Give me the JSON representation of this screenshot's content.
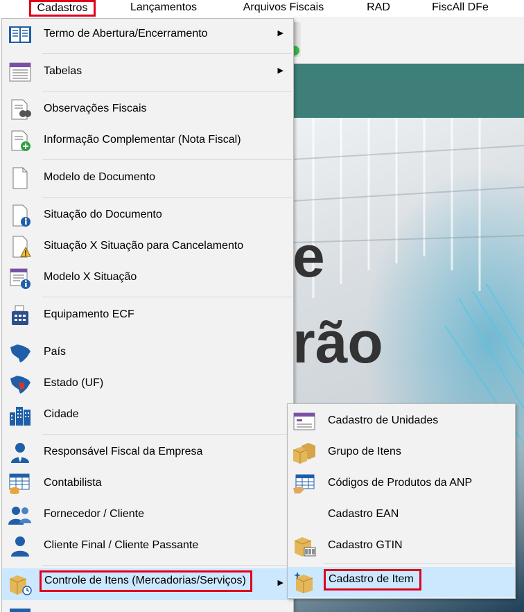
{
  "menubar": {
    "items": [
      {
        "label": "Cadastros",
        "highlighted": true
      },
      {
        "label": "Lançamentos",
        "highlighted": false
      },
      {
        "label": "Arquivos Fiscais",
        "highlighted": false
      },
      {
        "label": "RAD",
        "highlighted": false
      },
      {
        "label": "FiscAll DFe",
        "highlighted": false
      }
    ]
  },
  "main_menu": {
    "items": [
      {
        "label": "Termo de Abertura/Encerramento",
        "icon": "book-icon",
        "submenu": true
      },
      {
        "label": "Tabelas",
        "icon": "table-icon",
        "submenu": true
      },
      {
        "label": "Observações Fiscais",
        "icon": "document-search-icon",
        "submenu": false
      },
      {
        "label": "Informação Complementar (Nota Fiscal)",
        "icon": "document-add-icon",
        "submenu": false
      },
      {
        "label": "Modelo de Documento",
        "icon": "blank-document-icon",
        "submenu": false
      },
      {
        "label": "Situação do Documento",
        "icon": "document-info-icon",
        "submenu": false
      },
      {
        "label": "Situação X Situação para Cancelamento",
        "icon": "document-warning-icon",
        "submenu": false
      },
      {
        "label": "Modelo X Situação",
        "icon": "list-info-icon",
        "submenu": false
      },
      {
        "label": "Equipamento ECF",
        "icon": "cash-register-icon",
        "submenu": false
      },
      {
        "label": "País",
        "icon": "brazil-map-icon",
        "submenu": false
      },
      {
        "label": "Estado (UF)",
        "icon": "brazil-state-map-icon",
        "submenu": false
      },
      {
        "label": "Cidade",
        "icon": "city-buildings-icon",
        "submenu": false
      },
      {
        "label": "Responsável Fiscal da Empresa",
        "icon": "user-tie-icon",
        "submenu": false
      },
      {
        "label": "Contabilista",
        "icon": "spreadsheet-coins-icon",
        "submenu": false
      },
      {
        "label": "Fornecedor / Cliente",
        "icon": "users-group-icon",
        "submenu": false
      },
      {
        "label": "Cliente Final / Cliente Passante",
        "icon": "user-icon",
        "submenu": false
      },
      {
        "label": "Controle de Itens (Mercadorias/Serviços)",
        "icon": "package-clock-icon",
        "submenu": true,
        "active": true
      }
    ]
  },
  "sub_menu": {
    "items": [
      {
        "label": "Cadastro de Unidades",
        "icon": "window-list-icon"
      },
      {
        "label": "Grupo de Itens",
        "icon": "boxes-icon"
      },
      {
        "label": "Códigos de Produtos da ANP",
        "icon": "table-hand-icon"
      },
      {
        "label": "Cadastro EAN",
        "icon": ""
      },
      {
        "label": "Cadastro GTIN",
        "icon": "box-barcode-icon"
      },
      {
        "label": "Cadastro de Item",
        "icon": "box-sparkle-icon",
        "active": true
      }
    ]
  },
  "background": {
    "hero_line_1": "e",
    "hero_line_2": "rão"
  },
  "colors": {
    "highlight_border": "#e0001b",
    "menu_bg": "#f2f2f2",
    "active_item_bg": "#cce8ff",
    "teal_band": "#3f7f79"
  }
}
